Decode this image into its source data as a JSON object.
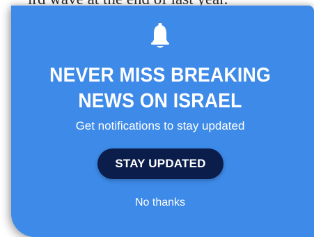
{
  "background_article": {
    "partial_text": "ird wave at the end of last year."
  },
  "popup": {
    "icon": "bell-icon",
    "headline_line1": "NEVER MISS BREAKING",
    "headline_line2": "NEWS ON ISRAEL",
    "subtext": "Get notifications to stay updated",
    "cta_label": "STAY UPDATED",
    "dismiss_label": "No thanks",
    "colors": {
      "panel": "#3d8ae8",
      "cta_background": "#0b1e4b",
      "text": "#ffffff"
    }
  }
}
